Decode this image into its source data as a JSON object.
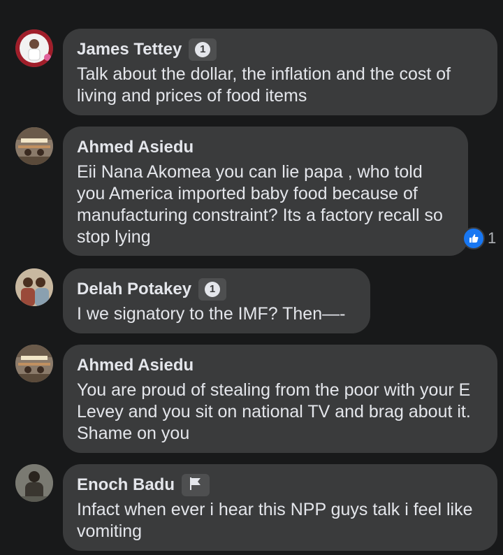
{
  "comments": [
    {
      "author": "James Tettey",
      "badge": "1",
      "text": "Talk about the dollar, the inflation and the cost of living and prices of food items"
    },
    {
      "author": "Ahmed Asiedu",
      "text": "Eii Nana Akomea you can lie papa , who told you America imported baby food because of manufacturing constraint? Its a factory recall so stop lying",
      "reaction_count": "1"
    },
    {
      "author": "Delah Potakey",
      "badge": "1",
      "text": "I we signatory to the IMF? Then—-"
    },
    {
      "author": "Ahmed Asiedu",
      "text": "You are proud of stealing from the poor with your E Levey and you sit on national TV and brag about it. Shame on you"
    },
    {
      "author": "Enoch Badu",
      "badge_icon": "flag-icon",
      "text": "Infact when ever i hear this NPP guys talk i feel like vomiting"
    }
  ],
  "colors": {
    "background": "#18191a",
    "bubble": "#3a3b3c",
    "text": "#e4e6eb",
    "like": "#1877f2"
  }
}
